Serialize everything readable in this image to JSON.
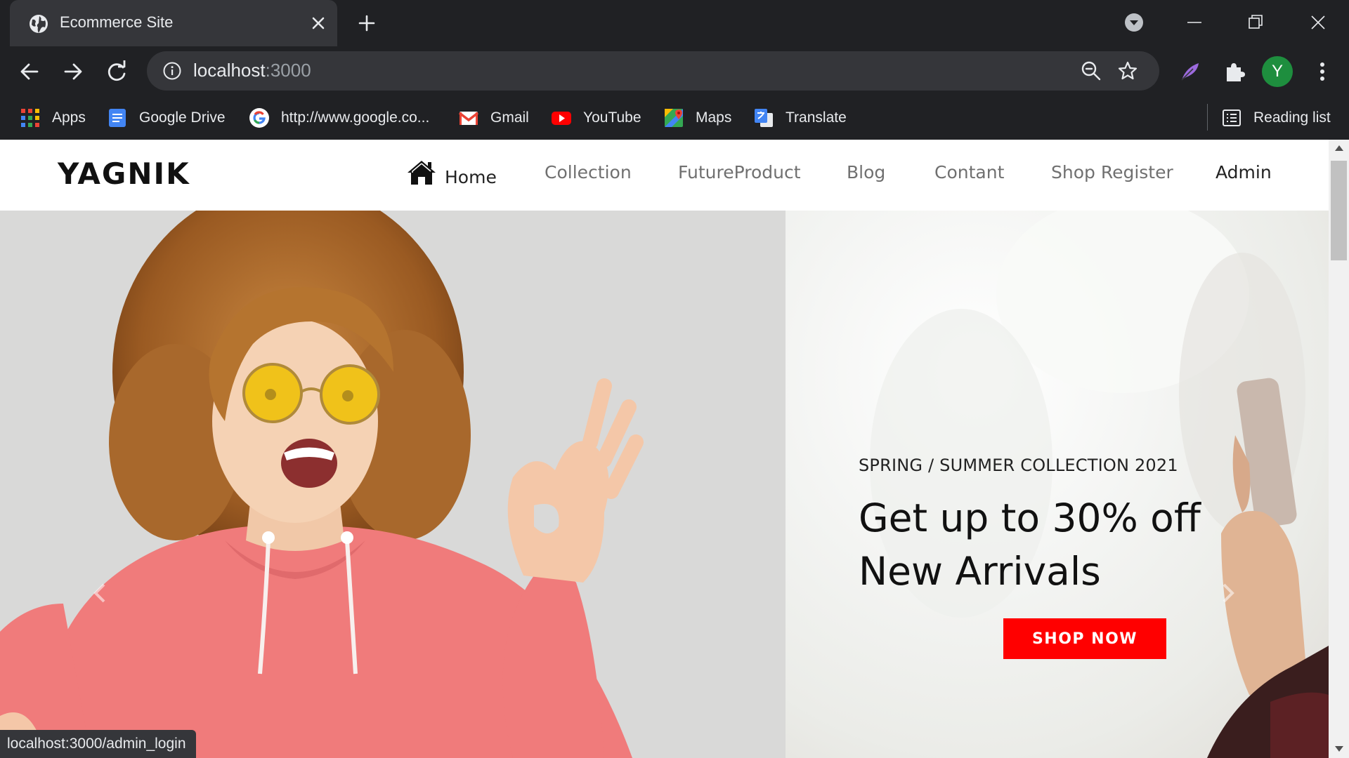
{
  "browser": {
    "tab_title": "Ecommerce Site",
    "url_host": "localhost",
    "url_port": ":3000",
    "profile_initial": "Y",
    "bookmarks": [
      {
        "label": "Apps",
        "icon": "apps-grid-icon"
      },
      {
        "label": "Google Drive",
        "icon": "google-docs-icon"
      },
      {
        "label": "http://www.google.co...",
        "icon": "google-g-icon"
      },
      {
        "label": "Gmail",
        "icon": "gmail-icon"
      },
      {
        "label": "YouTube",
        "icon": "youtube-icon"
      },
      {
        "label": "Maps",
        "icon": "maps-icon"
      },
      {
        "label": "Translate",
        "icon": "translate-icon"
      }
    ],
    "reading_list": "Reading list",
    "status_url": "localhost:3000/admin_login"
  },
  "site": {
    "logo": "YAGNIK",
    "nav": [
      "Home",
      "Collection",
      "FutureProduct",
      "Blog",
      "Contant",
      "Shop Register",
      "Admin"
    ],
    "hero": {
      "subtitle": "SPRING / SUMMER COLLECTION 2021",
      "title_line1": "Get up to 30% off",
      "title_line2": "New Arrivals",
      "cta": "SHOP NOW"
    }
  },
  "colors": {
    "chrome_bg": "#202124",
    "cta_red": "#ff0000",
    "profile_green": "#1e8e3e"
  }
}
